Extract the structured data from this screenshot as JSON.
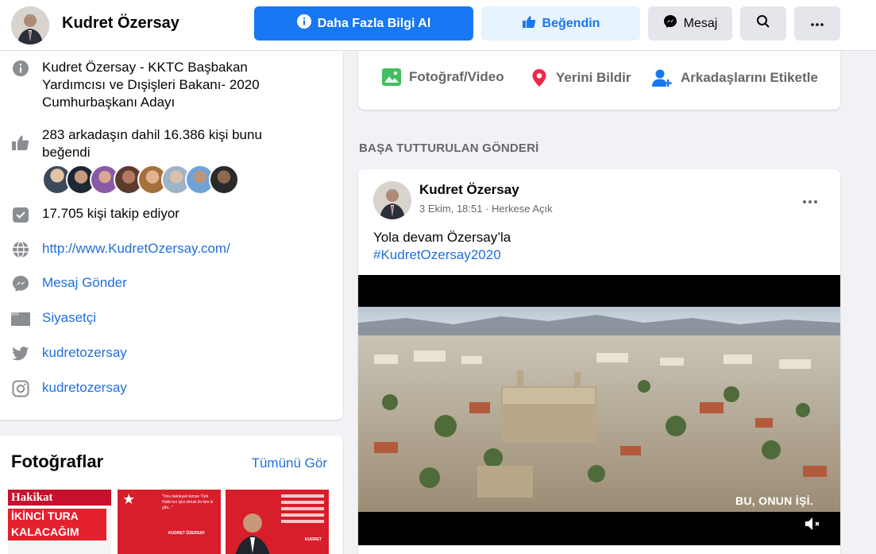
{
  "header": {
    "page_name": "Kudret Özersay",
    "more_info_label": "Daha Fazla Bilgi Al",
    "liked_label": "Beğendin",
    "message_label": "Mesaj"
  },
  "about": {
    "description": "Kudret Özersay - KKTC Başbakan Yardımcısı ve Dışişleri Bakanı- 2020 Cumhurbaşkanı Adayı",
    "likes_text": "283 arkadaşın dahil 16.386 kişi bunu beğendi",
    "followers_text": "17.705 kişi takip ediyor",
    "website": "http://www.KudretOzersay.com/",
    "send_message": "Mesaj Gönder",
    "category": "Siyasetçi",
    "twitter": "kudretozersay",
    "instagram": "kudretozersay"
  },
  "photos": {
    "title": "Fotoğraflar",
    "see_all": "Tümünü Gör",
    "thumb1_brand": "Hakikat",
    "thumb1_headline1": "İKİNCİ TURA",
    "thumb1_headline2": "KALACAĞIM",
    "thumb2_text": "\"Onu bekleyen kimse Türk Halkı'nın iyisi olmak ile kim ki gibi...\"",
    "thumb2_name": "KUDRET ÖZERSAY",
    "thumb3_name": "KUDRET"
  },
  "composer": {
    "photo_video": "Fotoğraf/Video",
    "check_in": "Yerini Bildir",
    "tag_friends": "Arkadaşlarını Etiketle"
  },
  "pinned_label": "BAŞA TUTTURULAN GÖNDERİ",
  "post": {
    "author": "Kudret Özersay",
    "meta": "3 Ekim, 18:51 · Herkese Açık",
    "text": "Yola devam Özersay’la",
    "hashtag": "#KudretOzersay2020",
    "video_caption": "BU, ONUN İŞİ."
  },
  "colors": {
    "primary": "#1877f2",
    "link": "#216fdb",
    "muted": "#65676b",
    "liked_bg": "#e7f3ff"
  },
  "icons": [
    "info-icon",
    "thumbs-up-icon",
    "messenger-icon",
    "search-icon",
    "more-dots-icon",
    "followers-icon",
    "globe-icon",
    "category-icon",
    "twitter-icon",
    "instagram-icon",
    "photo-icon",
    "location-icon",
    "tag-friends-icon",
    "volume-icon"
  ]
}
